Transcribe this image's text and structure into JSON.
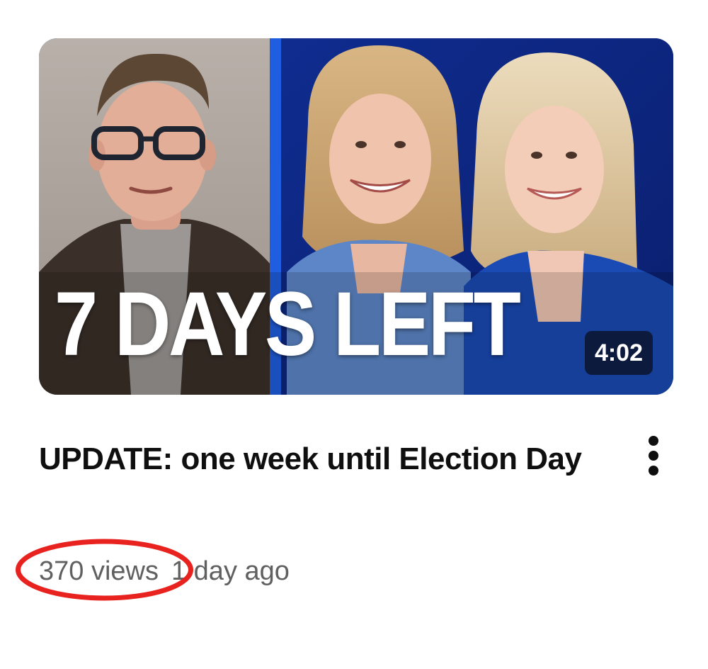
{
  "video": {
    "thumbnail_overlay_text": "7 DAYS LEFT",
    "duration": "4:02",
    "title": "UPDATE: one week until Election Day",
    "views": "370 views",
    "age": "1 day ago"
  },
  "menu": {
    "icon": "more-vert-icon"
  },
  "annotation": {
    "highlight_color": "#e8231f"
  }
}
